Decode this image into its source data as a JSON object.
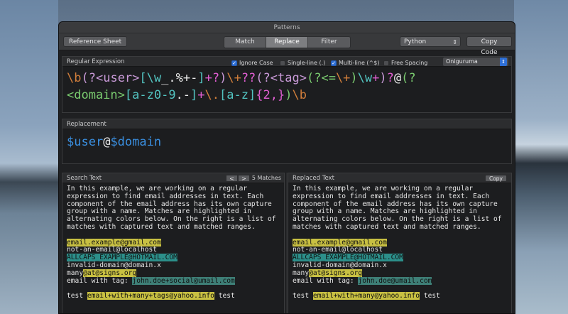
{
  "window": {
    "title": "Patterns"
  },
  "toolbar": {
    "reference_sheet": "Reference Sheet",
    "tabs": [
      {
        "label": "Match"
      },
      {
        "label": "Replace"
      },
      {
        "label": "Filter"
      }
    ],
    "active_tab": "Replace",
    "language": "Python",
    "copy_code": "Copy Code"
  },
  "regex": {
    "header": "Regular Expression",
    "options": [
      {
        "label": "Ignore Case",
        "checked": true
      },
      {
        "label": "Single-line (.)",
        "checked": false
      },
      {
        "label": "Multi-line (^$)",
        "checked": true
      },
      {
        "label": "Free Spacing",
        "checked": false
      }
    ],
    "engine": "Oniguruma",
    "tokens_line1": [
      {
        "t": "\\b",
        "c": "#d17e3b"
      },
      {
        "t": "(",
        "c": "#c99ad8"
      },
      {
        "t": "?<",
        "c": "#c99ad8"
      },
      {
        "t": "user",
        "c": "#c99ad8"
      },
      {
        "t": ">",
        "c": "#c99ad8"
      },
      {
        "t": "[",
        "c": "#52c3c0"
      },
      {
        "t": "\\w",
        "c": "#52c3c0"
      },
      {
        "t": "_.%+-",
        "c": "#e9e9e9"
      },
      {
        "t": "]",
        "c": "#52c3c0"
      },
      {
        "t": "+?",
        "c": "#e15fd2"
      },
      {
        "t": ")",
        "c": "#c99ad8"
      },
      {
        "t": "\\+",
        "c": "#d17e3b"
      },
      {
        "t": "??",
        "c": "#e15fd2"
      },
      {
        "t": "(?<",
        "c": "#c99ad8"
      },
      {
        "t": "tag",
        "c": "#c99ad8"
      },
      {
        "t": ">",
        "c": "#c99ad8"
      },
      {
        "t": "(?<=",
        "c": "#7acb6f"
      },
      {
        "t": "\\+",
        "c": "#d17e3b"
      },
      {
        "t": ")",
        "c": "#7acb6f"
      },
      {
        "t": "\\w",
        "c": "#52c3c0"
      },
      {
        "t": "+",
        "c": "#e15fd2"
      },
      {
        "t": ")",
        "c": "#c99ad8"
      },
      {
        "t": "?",
        "c": "#e15fd2"
      },
      {
        "t": "@",
        "c": "#e9e9e9"
      },
      {
        "t": "(?",
        "c": "#7acb6f"
      }
    ],
    "tokens_line2": [
      {
        "t": "<domain>",
        "c": "#7acb6f"
      },
      {
        "t": "[",
        "c": "#52c3c0"
      },
      {
        "t": "a-z0-9",
        "c": "#52c3c0"
      },
      {
        "t": ".-",
        "c": "#e9e9e9"
      },
      {
        "t": "]",
        "c": "#52c3c0"
      },
      {
        "t": "+",
        "c": "#e15fd2"
      },
      {
        "t": "\\.",
        "c": "#d17e3b"
      },
      {
        "t": "[",
        "c": "#52c3c0"
      },
      {
        "t": "a-z",
        "c": "#52c3c0"
      },
      {
        "t": "]",
        "c": "#52c3c0"
      },
      {
        "t": "{2,}",
        "c": "#e15fd2"
      },
      {
        "t": ")",
        "c": "#7acb6f"
      },
      {
        "t": "\\b",
        "c": "#d17e3b"
      }
    ]
  },
  "replacement": {
    "header": "Replacement",
    "tokens": [
      {
        "t": "$user",
        "c": "#3a8fe0"
      },
      {
        "t": "@",
        "c": "#e9e9e9"
      },
      {
        "t": "$domain",
        "c": "#3a8fe0"
      }
    ]
  },
  "search": {
    "header": "Search Text",
    "prev": "<",
    "next": ">",
    "matches": "5 Matches",
    "intro": [
      "In this example, we are working on a regular",
      "expression to find email addresses in text. Each",
      "component of the email address has its own capture",
      "group with a name. Matches are highlighted in",
      "alternating colors below. On the right is a list of",
      "matches with captured text and matched ranges."
    ],
    "lines": [
      [
        {
          "t": "email.example@gmail.com",
          "h": "y"
        }
      ],
      [
        {
          "t": "not-an-email@localhost",
          "h": ""
        }
      ],
      [
        {
          "t": "ALLCAPS_EXAMPLE@HOTMAIL.COM",
          "h": "b"
        }
      ],
      [
        {
          "t": "invalid-domain@domain.x",
          "h": ""
        }
      ],
      [
        {
          "t": "many",
          "h": ""
        },
        {
          "t": "@at@signs.org",
          "h": "y"
        }
      ],
      [
        {
          "t": "email with tag: ",
          "h": ""
        },
        {
          "t": "john.doe+social@umail.com",
          "h": "g"
        }
      ],
      [
        {
          "t": "",
          "h": ""
        }
      ],
      [
        {
          "t": "test ",
          "h": ""
        },
        {
          "t": "email+with+many+tags@yahoo.info",
          "h": "y"
        },
        {
          "t": " test",
          "h": ""
        }
      ]
    ]
  },
  "replaced": {
    "header": "Replaced Text",
    "copy": "Copy",
    "intro": [
      "In this example, we are working on a regular",
      "expression to find email addresses in text. Each",
      "component of the email address has its own capture",
      "group with a name. Matches are highlighted in",
      "alternating colors below. On the right is a list of",
      "matches with captured text and matched ranges."
    ],
    "lines": [
      [
        {
          "t": "email.example@gmail.com",
          "h": "y"
        }
      ],
      [
        {
          "t": "not-an-email@localhost",
          "h": ""
        }
      ],
      [
        {
          "t": "ALLCAPS_EXAMPLE@HOTMAIL.COM",
          "h": "b"
        }
      ],
      [
        {
          "t": "invalid-domain@domain.x",
          "h": ""
        }
      ],
      [
        {
          "t": "many",
          "h": ""
        },
        {
          "t": "@at@signs.org",
          "h": "y"
        }
      ],
      [
        {
          "t": "email with tag: ",
          "h": ""
        },
        {
          "t": "john.doe@umail.com",
          "h": "g"
        }
      ],
      [
        {
          "t": "",
          "h": ""
        }
      ],
      [
        {
          "t": "test ",
          "h": ""
        },
        {
          "t": "email+with+many@yahoo.info",
          "h": "y"
        },
        {
          "t": " test",
          "h": ""
        }
      ]
    ]
  }
}
